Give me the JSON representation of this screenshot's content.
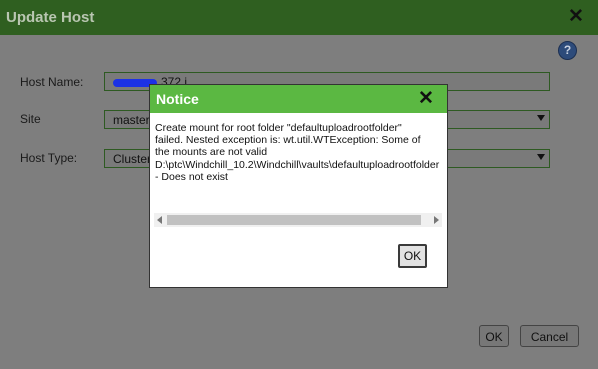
{
  "dialog": {
    "title": "Update Host",
    "close_glyph": "✕",
    "help_glyph": "?",
    "labels": {
      "host_name": "Host Name:",
      "site": "Site",
      "host_type": "Host Type:"
    },
    "fields": {
      "host_name_value": "372 i",
      "site_value": "master",
      "host_type_value": "Cluster"
    },
    "buttons": {
      "ok": "OK",
      "cancel": "Cancel"
    }
  },
  "notice": {
    "title": "Notice",
    "close_glyph": "✕",
    "message": "Create mount for root folder \"defaultuploadrootfolder\"\nfailed. Nested exception is: wt.util.WTException: Some of\nthe mounts are not valid\nD:\\ptc\\Windchill_10.2\\Windchill\\vaults\\defaultuploadrootfolder\n- Does not exist",
    "ok_label": "OK"
  },
  "colors": {
    "dialog_header": "#2f5f20",
    "notice_header": "#5bb842",
    "overlay": "#7e7e7e"
  }
}
